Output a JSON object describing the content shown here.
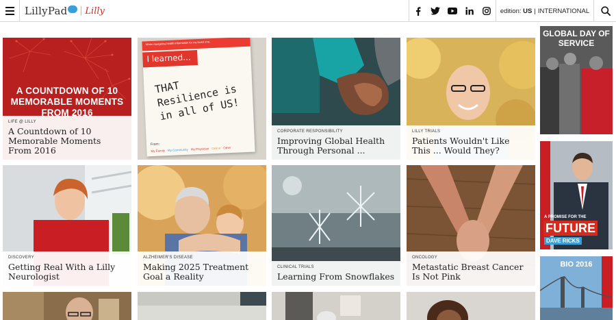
{
  "header": {
    "brand": "LillyPad",
    "brand_partner": "Lilly",
    "edition_prefix": "edition:",
    "edition_current": "US",
    "edition_other": "INTERNATIONAL",
    "social": [
      "facebook-icon",
      "twitter-icon",
      "youtube-icon",
      "linkedin-icon",
      "instagram-icon"
    ]
  },
  "tiles": [
    {
      "category": "LIFE @ LILLY",
      "title": "A Countdown of 10 Memorable Moments From 2016",
      "overlay": "A COUNTDOWN OF 10 MEMORABLE MOMENTS FROM 2016"
    },
    {
      "category": "",
      "title": "",
      "card_header": "I learned...",
      "card_note": "When navigating health information for my loved one,",
      "handwriting": "THAT Resilience is in all of US!",
      "card_footer_from": "From:",
      "card_footer_tags": [
        "My Family",
        "My Community",
        "My Physician",
        "Online",
        "Other"
      ]
    },
    {
      "category": "CORPORATE RESPONSIBILITY",
      "title": "Improving Global Health Through Personal ..."
    },
    {
      "category": "LILLY TRIALS",
      "title": "Patients Wouldn't Like This ... Would They?"
    },
    {
      "category": "DISCOVERY",
      "title": "Getting Real With a Lilly Neurologist"
    },
    {
      "category": "ALZHEIMER'S DISEASE",
      "title": "Making 2025 Treatment Goal a Reality"
    },
    {
      "category": "CLINICAL TRIALS",
      "title": "Learning From Snowflakes"
    },
    {
      "category": "ONCOLOGY",
      "title": "Metastatic Breast Cancer Is Not Pink"
    }
  ],
  "sidebar": {
    "service": "GLOBAL DAY OF SERVICE",
    "promise_line": "A PROMISE FOR THE",
    "promise_big": "FUTURE",
    "promise_name": "DAVE RICKS",
    "bio": "BIO 2016"
  },
  "colors": {
    "accent_red": "#d52b1e",
    "brand_blue": "#3a9fd8",
    "header_border": "#d6d6d6"
  }
}
